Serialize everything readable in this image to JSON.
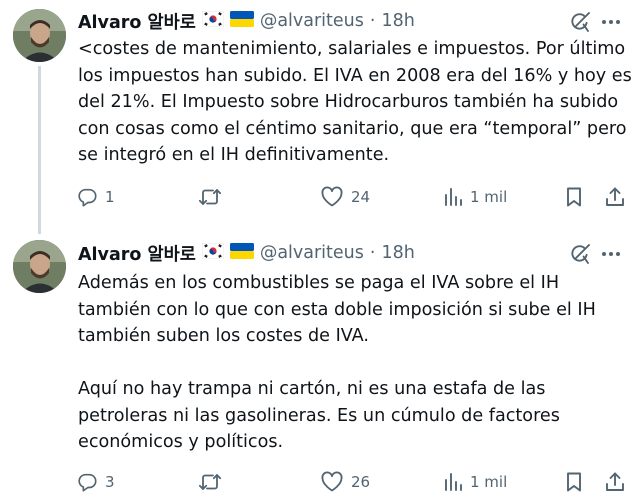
{
  "tweets": [
    {
      "name": "Alvaro 알바로",
      "handle": "@alvariteus",
      "separator": "·",
      "time": "18h",
      "text": "<costes de mantenimiento, salariales e impuestos. Por último los impuestos han subido. El IVA en 2008 era del 16% y hoy es del 21%. El Impuesto sobre Hidrocarburos también ha subido con cosas como el céntimo sanitario, que era “temporal” pero se integró en el IH definitivamente.",
      "replies": "1",
      "retweets": "",
      "likes": "24",
      "views": "1 mil"
    },
    {
      "name": "Alvaro 알바로",
      "handle": "@alvariteus",
      "separator": "·",
      "time": "18h",
      "text": "Además en los combustibles se paga el IVA sobre el IH también con lo que con esta doble imposición si sube el IH también suben los costes de IVA.\n\nAquí no hay trampa ni cartón, ni es una estafa de las petroleras ni las gasolineras. Es un cúmulo de factores económicos y políticos.",
      "replies": "3",
      "retweets": "",
      "likes": "26",
      "views": "1 mil"
    }
  ],
  "icons": {
    "flags": [
      "south-korea-flag",
      "ukraine-flag"
    ],
    "header": [
      "grok-icon",
      "more-icon"
    ],
    "actions": [
      "reply-icon",
      "retweet-icon",
      "like-icon",
      "views-icon",
      "bookmark-icon",
      "share-icon"
    ]
  },
  "colors": {
    "text": "#0f1419",
    "secondary": "#536471",
    "thread_line": "#cfd9de"
  }
}
